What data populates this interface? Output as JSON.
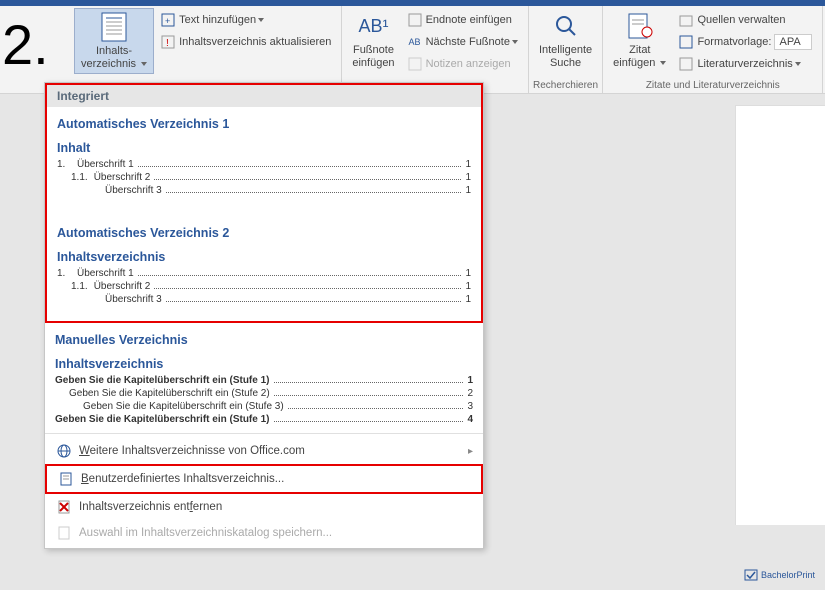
{
  "step": "2.",
  "ribbon": {
    "toc_button": "Inhalts-\nverzeichnis",
    "add_text": "Text hinzufügen",
    "update_toc": "Inhaltsverzeichnis aktualisieren",
    "footnote_btn": "Fußnote\neinfügen",
    "insert_endnote": "Endnote einfügen",
    "next_footnote": "Nächste Fußnote",
    "show_notes": "Notizen anzeigen",
    "smart_lookup": "Intelligente\nSuche",
    "group_research": "Recherchieren",
    "insert_citation": "Zitat\neinfügen",
    "manage_sources": "Quellen verwalten",
    "style_label": "Formatvorlage:",
    "style_value": "APA",
    "bibliography": "Literaturverzeichnis",
    "group_citations": "Zitate und Literaturverzeichnis",
    "ab_label": "AB¹",
    "ab_small": "AB"
  },
  "dropdown": {
    "builtin": "Integriert",
    "auto1": {
      "title": "Automatisches Verzeichnis 1",
      "heading": "Inhalt",
      "rows": [
        {
          "num": "1.",
          "txt": "Überschrift 1",
          "pg": "1",
          "indent": 0
        },
        {
          "num": "1.1.",
          "txt": "Überschrift 2",
          "pg": "1",
          "indent": 1
        },
        {
          "num": "",
          "txt": "Überschrift 3",
          "pg": "1",
          "indent": 2
        }
      ]
    },
    "auto2": {
      "title": "Automatisches Verzeichnis 2",
      "heading": "Inhaltsverzeichnis",
      "rows": [
        {
          "num": "1.",
          "txt": "Überschrift 1",
          "pg": "1",
          "indent": 0
        },
        {
          "num": "1.1.",
          "txt": "Überschrift 2",
          "pg": "1",
          "indent": 1
        },
        {
          "num": "",
          "txt": "Überschrift 3",
          "pg": "1",
          "indent": 2
        }
      ]
    },
    "manual": {
      "title": "Manuelles Verzeichnis",
      "heading": "Inhaltsverzeichnis",
      "rows": [
        {
          "txt": "Geben Sie die Kapitelüberschrift ein (Stufe 1)",
          "pg": "1",
          "indent": 0,
          "bold": true
        },
        {
          "txt": "Geben Sie die Kapitelüberschrift ein (Stufe 2)",
          "pg": "2",
          "indent": 1
        },
        {
          "txt": "Geben Sie die Kapitelüberschrift ein (Stufe 3)",
          "pg": "3",
          "indent": 2
        },
        {
          "txt": "Geben Sie die Kapitelüberschrift ein (Stufe 1)",
          "pg": "4",
          "indent": 0,
          "bold": true
        }
      ]
    },
    "more_office": "Weitere Inhaltsverzeichnisse von Office.com",
    "custom_toc": "Benutzerdefiniertes Inhaltsverzeichnis...",
    "remove_toc": "Inhaltsverzeichnis entfernen",
    "save_selection": "Auswahl im Inhaltsverzeichniskatalog speichern...",
    "underline_letter_w": "W",
    "underline_letter_b": "B",
    "underline_letter_f": "f"
  },
  "logo": "BachelorPrint"
}
